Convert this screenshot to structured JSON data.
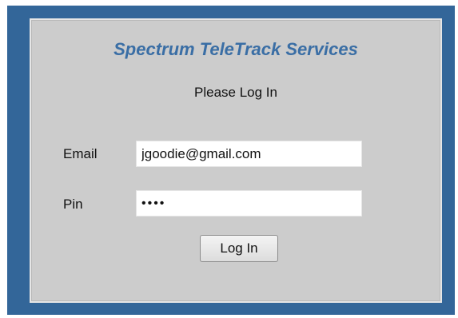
{
  "app_title": "Spectrum TeleTrack Services",
  "prompt": "Please Log In",
  "form": {
    "email_label": "Email",
    "email_value": "jgoodie@gmail.com",
    "pin_label": "Pin",
    "pin_value": "1234",
    "submit_label": "Log In"
  },
  "colors": {
    "frame": "#336699",
    "panel": "#cccccc",
    "title": "#3a6ea5"
  }
}
